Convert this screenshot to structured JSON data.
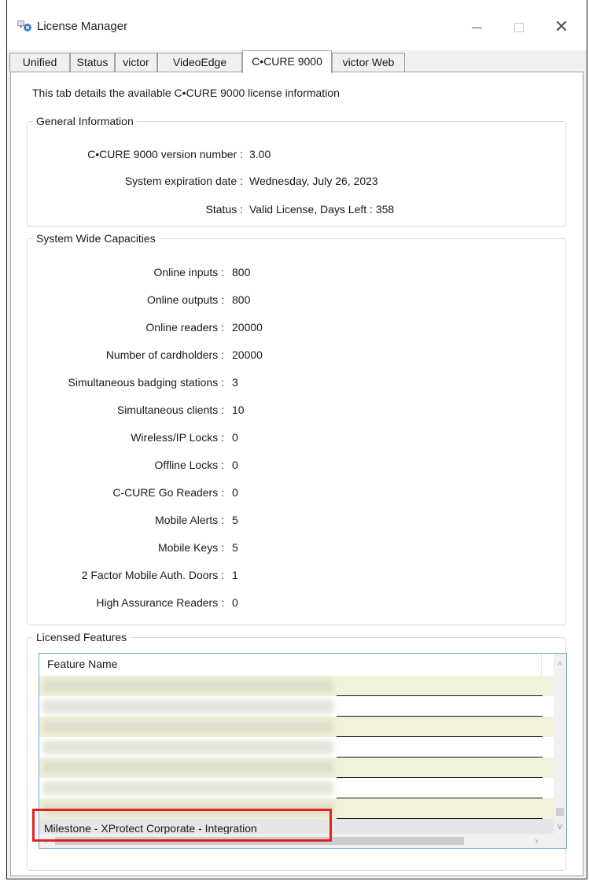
{
  "window": {
    "title": "License Manager"
  },
  "tabs": [
    {
      "label": "Unified"
    },
    {
      "label": "Status"
    },
    {
      "label": "victor"
    },
    {
      "label": "VideoEdge"
    },
    {
      "label": "C•CURE 9000"
    },
    {
      "label": "victor Web"
    }
  ],
  "intro": "This tab details the available C•CURE 9000 license information",
  "general": {
    "legend": "General Information",
    "rows": [
      {
        "label": "C•CURE 9000 version number :",
        "value": "3.00"
      },
      {
        "label": "System expiration date :",
        "value": "Wednesday, July 26, 2023"
      },
      {
        "label": "Status :",
        "value": "Valid License, Days Left : 358"
      }
    ]
  },
  "capacities": {
    "legend": "System Wide Capacities",
    "rows": [
      {
        "label": "Online inputs :",
        "value": "800"
      },
      {
        "label": "Online outputs :",
        "value": "800"
      },
      {
        "label": "Online readers :",
        "value": "20000"
      },
      {
        "label": "Number of cardholders :",
        "value": "20000"
      },
      {
        "label": "Simultaneous badging stations :",
        "value": "3"
      },
      {
        "label": "Simultaneous clients :",
        "value": "10"
      },
      {
        "label": "Wireless/IP Locks :",
        "value": "0"
      },
      {
        "label": "Offline Locks :",
        "value": "0"
      },
      {
        "label": "C-CURE Go Readers :",
        "value": "0"
      },
      {
        "label": "Mobile Alerts :",
        "value": "5"
      },
      {
        "label": "Mobile Keys :",
        "value": "5"
      },
      {
        "label": "2 Factor Mobile Auth. Doors :",
        "value": "1"
      },
      {
        "label": "High Assurance Readers :",
        "value": "0"
      }
    ]
  },
  "features": {
    "legend": "Licensed Features",
    "column_header": "Feature Name",
    "selected_row": "Milestone - XProtect Corporate - Integration"
  },
  "colors": {
    "highlight": "#e32222",
    "row_alt": "#f2f2dc",
    "listview_border": "#7aa4d0"
  }
}
